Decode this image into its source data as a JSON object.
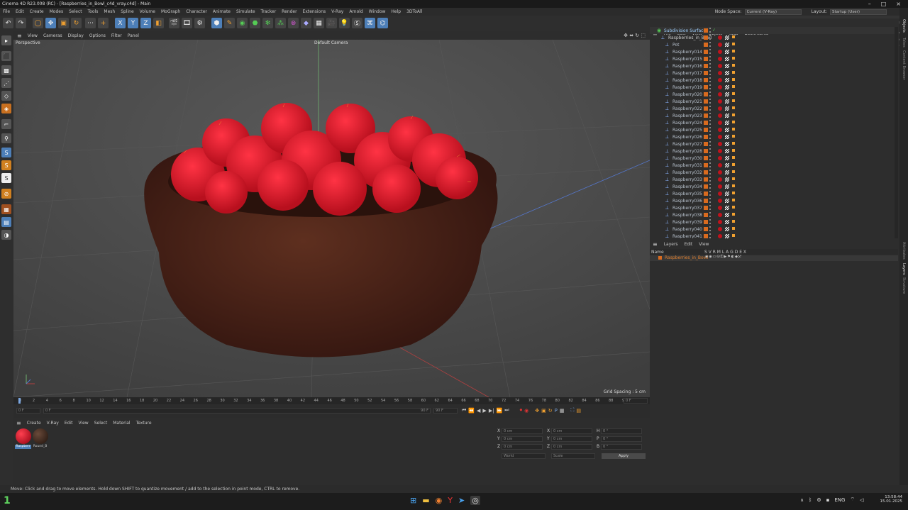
{
  "window": {
    "title": "Cinema 4D R23.008 (RC) - [Raspberries_in_Bowl_c4d_vray.c4d] - Main"
  },
  "menu": {
    "items": [
      "File",
      "Edit",
      "Create",
      "Modes",
      "Select",
      "Tools",
      "Mesh",
      "Spline",
      "Volume",
      "MoGraph",
      "Character",
      "Animate",
      "Simulate",
      "Tracker",
      "Render",
      "Extensions",
      "V-Ray",
      "Arnold",
      "Window",
      "Help",
      "3DToAll"
    ],
    "node_space_label": "Node Space:",
    "node_space_value": "Current (V-Ray)",
    "layout_label": "Layout:",
    "layout_value": "Startup (User)"
  },
  "toolbar": {
    "axis_x": "X",
    "axis_y": "Y",
    "axis_z": "Z"
  },
  "viewport": {
    "menu": [
      "View",
      "Cameras",
      "Display",
      "Options",
      "Filter",
      "Panel"
    ],
    "label": "Perspective",
    "camera": "Default Camera",
    "grid_spacing": "Grid Spacing : 5 cm"
  },
  "timeline": {
    "ticks": [
      "0",
      "2",
      "4",
      "6",
      "8",
      "10",
      "12",
      "14",
      "16",
      "18",
      "20",
      "22",
      "24",
      "26",
      "28",
      "30",
      "32",
      "34",
      "36",
      "38",
      "40",
      "42",
      "44",
      "46",
      "48",
      "50",
      "52",
      "54",
      "56",
      "58",
      "60",
      "62",
      "64",
      "66",
      "68",
      "70",
      "72",
      "74",
      "76",
      "78",
      "80",
      "82",
      "84",
      "86",
      "88",
      "90"
    ],
    "current_frame": "0 F",
    "start_frame": "0 F",
    "range_start": "0 F",
    "range_end": "90 F",
    "end_frame": "90 F",
    "end_field": "0 F"
  },
  "materials": {
    "menu": [
      "Create",
      "V-Ray",
      "Edit",
      "View",
      "Select",
      "Material",
      "Texture"
    ],
    "items": [
      {
        "label": "Raspberr",
        "color": "#c0121c"
      },
      {
        "label": "Round_B",
        "color": "#3b2a22"
      }
    ]
  },
  "coords": {
    "rows": [
      {
        "a": "X",
        "av": "0 cm",
        "b": "X",
        "bv": "0 cm",
        "c": "H",
        "cv": "0 °"
      },
      {
        "a": "Y",
        "av": "0 cm",
        "b": "Y",
        "bv": "0 cm",
        "c": "P",
        "cv": "0 °"
      },
      {
        "a": "Z",
        "av": "0 cm",
        "b": "Z",
        "bv": "0 cm",
        "c": "B",
        "cv": "0 °"
      }
    ],
    "mode1": "World",
    "mode2": "Scale",
    "apply": "Apply"
  },
  "objects": {
    "menu": [
      "File",
      "Edit",
      "View",
      "Object",
      "Tags",
      "Bookmarks"
    ],
    "root": "Subdivision Surface",
    "group": "Raspberries_in_Bowl",
    "items": [
      "Pot",
      "Raspberry014",
      "Raspberry015",
      "Raspberry016",
      "Raspberry017",
      "Raspberry018",
      "Raspberry019",
      "Raspberry020",
      "Raspberry021",
      "Raspberry022",
      "Raspberry023",
      "Raspberry024",
      "Raspberry025",
      "Raspberry026",
      "Raspberry027",
      "Raspberry028",
      "Raspberry030",
      "Raspberry031",
      "Raspberry032",
      "Raspberry033",
      "Raspberry034",
      "Raspberry035",
      "Raspberry036",
      "Raspberry037",
      "Raspberry038",
      "Raspberry039",
      "Raspberry040",
      "Raspberry041"
    ]
  },
  "layers": {
    "menu": [
      "Layers",
      "Edit",
      "View"
    ],
    "header_name": "Name",
    "header_cols": "S V R M L A G D E X",
    "item": "Raspberries_in_Bowl"
  },
  "sidetabs": [
    "Objects",
    "Takes",
    "Content Browser",
    "Attributes",
    "Layers",
    "Structure"
  ],
  "status": {
    "text": "Move: Click and drag to move elements. Hold down SHIFT to quantize movement / add to the selection in point mode, CTRL to remove."
  },
  "taskbar": {
    "lang": "ENG",
    "time": "13:58:44",
    "date": "15.01.2025"
  },
  "colors": {
    "accent": "#4d7fb8",
    "raspberry": "#e0162a",
    "bowl": "#4a2418"
  }
}
